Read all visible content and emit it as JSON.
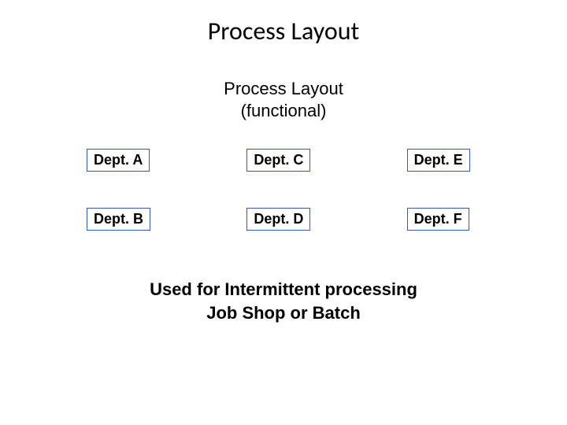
{
  "title": "Process Layout",
  "subtitle_line1": "Process Layout",
  "subtitle_line2": "(functional)",
  "departments": {
    "r1c1": "Dept. A",
    "r1c2": "Dept. C",
    "r1c3": "Dept. E",
    "r2c1": "Dept. B",
    "r2c2": "Dept. D",
    "r2c3": "Dept. F"
  },
  "caption_line1": "Used for Intermittent processing",
  "caption_line2": "Job Shop or Batch"
}
